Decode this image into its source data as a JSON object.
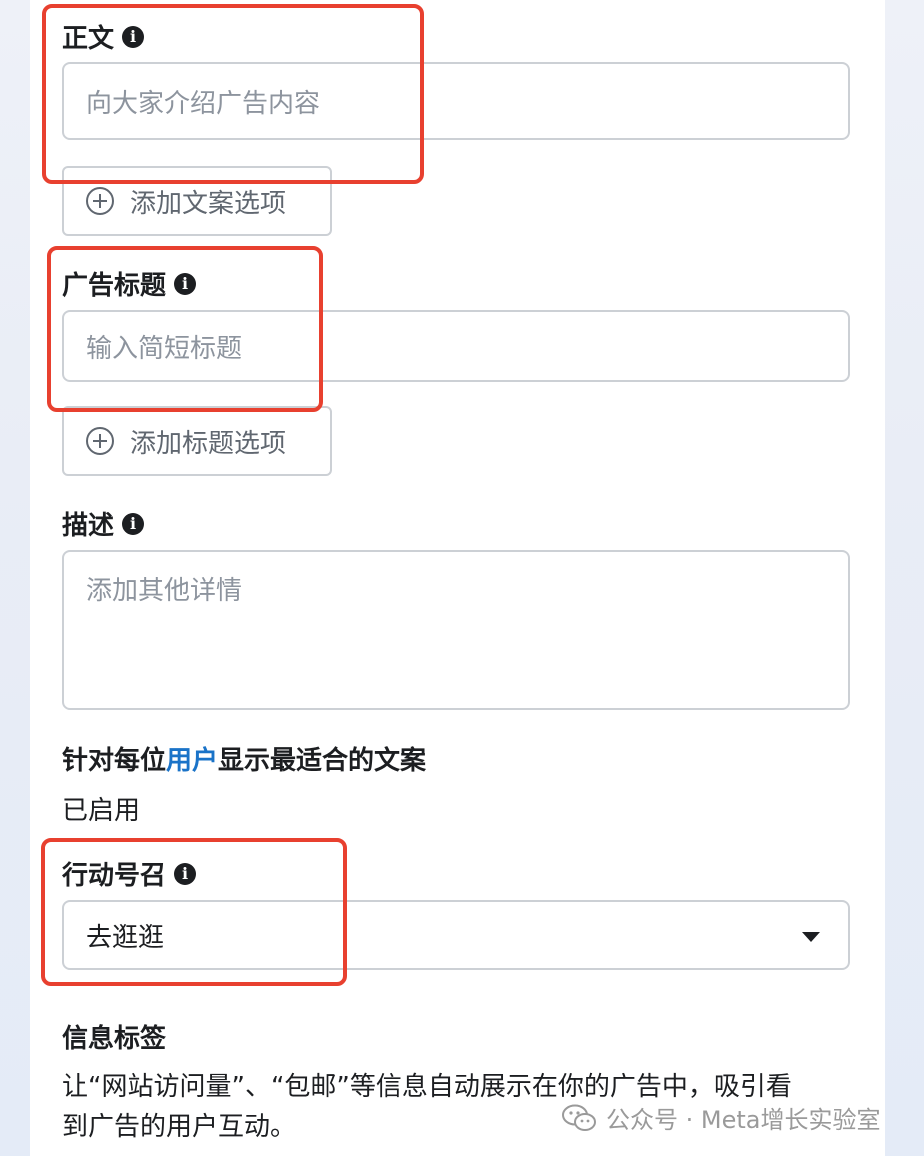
{
  "body_text": {
    "label": "正文",
    "placeholder": "向大家介绍广告内容",
    "add_button": "添加文案选项"
  },
  "headline": {
    "label": "广告标题",
    "placeholder": "输入简短标题",
    "add_button": "添加标题选项"
  },
  "description": {
    "label": "描述",
    "placeholder": "添加其他详情"
  },
  "optimize": {
    "title_prefix": "针对每位",
    "title_link": "用户",
    "title_suffix": "显示最适合的文案",
    "status": "已启用"
  },
  "cta": {
    "label": "行动号召",
    "value": "去逛逛"
  },
  "info_labels": {
    "title": "信息标签",
    "line1": "让“网站访问量”、“包邮”等信息自动展示在你的广告中，吸引看",
    "line2": "到广告的用户互动。"
  },
  "watermark": {
    "text": "公众号 · Meta增长实验室"
  },
  "colors": {
    "highlight": "#e8402f",
    "link": "#1a73c8"
  }
}
